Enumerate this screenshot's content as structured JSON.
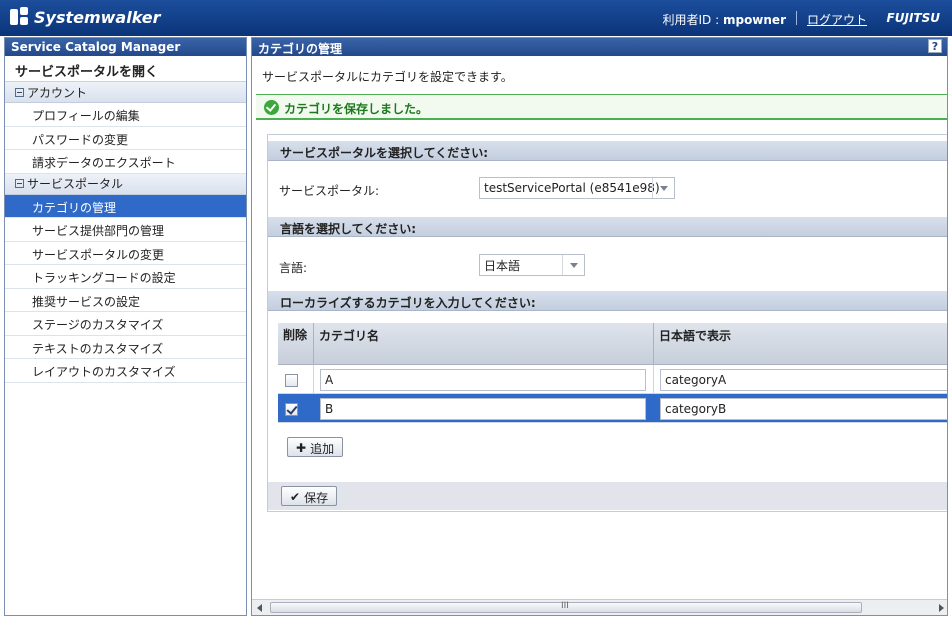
{
  "header": {
    "brand": "Systemwalker",
    "user_label": "利用者ID : ",
    "user_name": "mpowner",
    "logout": "ログアウト",
    "company": "FUJITSU"
  },
  "sidebar": {
    "title": "Service Catalog Manager",
    "portal_link": "サービスポータルを開く",
    "groups": [
      {
        "label": "アカウント",
        "items": [
          "プロフィールの編集",
          "パスワードの変更",
          "請求データのエクスポート"
        ]
      },
      {
        "label": "サービスポータル",
        "items": [
          "カテゴリの管理",
          "サービス提供部門の管理",
          "サービスポータルの変更",
          "トラッキングコードの設定",
          "推奨サービスの設定",
          "ステージのカスタマイズ",
          "テキストのカスタマイズ",
          "レイアウトのカスタマイズ"
        ]
      }
    ],
    "active_item": "カテゴリの管理"
  },
  "main": {
    "title": "カテゴリの管理",
    "help": "?",
    "description": "サービスポータルにカテゴリを設定できます。",
    "success_message": "カテゴリを保存しました。",
    "sections": {
      "portal": {
        "heading": "サービスポータルを選択してください:",
        "label": "サービスポータル:",
        "value": "testServicePortal (e8541e98)"
      },
      "language": {
        "heading": "言語を選択してください:",
        "label": "言語:",
        "value": "日本語"
      },
      "categories": {
        "heading": "ローカライズするカテゴリを入力してください:"
      }
    },
    "table": {
      "columns": [
        "削除",
        "カテゴリ名",
        "日本語で表示"
      ],
      "rows": [
        {
          "delete": false,
          "name": "A",
          "display": "categoryA",
          "selected": false
        },
        {
          "delete": true,
          "name": "B",
          "display": "categoryB",
          "selected": true
        }
      ]
    },
    "add_button": "追加",
    "save_button": "保存",
    "scrollbar_grip": "III"
  },
  "colors": {
    "header": "#0b3479",
    "accent": "#2f6ac8",
    "success": "#4caf50"
  }
}
